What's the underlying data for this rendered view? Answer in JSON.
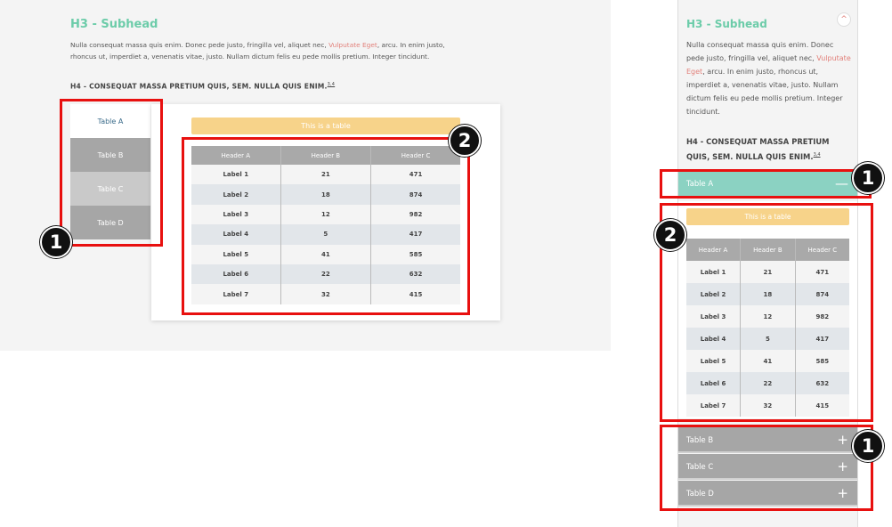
{
  "desktop": {
    "h3": "H3 - Subhead",
    "para_before": "Nulla consequat massa quis enim. Donec pede justo, fringilla vel, aliquet nec,",
    "para_link": "Vulputate Eget",
    "para_after": ", arcu. In enim justo, rhoncus ut, imperdiet a, venenatis vitae, justo. Nullam dictum felis eu pede mollis pretium. Integer tincidunt.",
    "h4": "H4 - CONSEQUAT MASSA PRETIUM QUIS, SEM. NULLA QUIS ENIM.",
    "h4_sup": "3,4",
    "tabs": [
      "Table A",
      "Table B",
      "Table C",
      "Table D"
    ],
    "caption": "This is a table"
  },
  "mobile": {
    "h3": "H3 - Subhead",
    "collapse_glyph": "^",
    "para_before": "Nulla consequat massa quis enim. Donec pede justo, fringilla vel, aliquet nec,",
    "para_link": "Vulputate Eget",
    "para_after": ", arcu. In enim justo, rhoncus ut, imperdiet a, venenatis vitae, justo. Nullam dictum felis eu pede mollis pretium. Integer tincidunt.",
    "h4": "H4 - CONSEQUAT MASSA PRETIUM QUIS, SEM. NULLA QUIS ENIM.",
    "h4_sup": "3,4",
    "acc_a": "Table A",
    "acc_a_sign": "—",
    "acc_b": "Table B",
    "acc_c": "Table C",
    "acc_d": "Table D",
    "plus_sign": "+",
    "caption": "This is a table"
  },
  "table": {
    "headers": [
      "Header A",
      "Header B",
      "Header C"
    ],
    "rows": [
      [
        "Label 1",
        "21",
        "471"
      ],
      [
        "Label 2",
        "18",
        "874"
      ],
      [
        "Label 3",
        "12",
        "982"
      ],
      [
        "Label 4",
        "5",
        "417"
      ],
      [
        "Label 5",
        "41",
        "585"
      ],
      [
        "Label 6",
        "22",
        "632"
      ],
      [
        "Label 7",
        "32",
        "415"
      ]
    ]
  },
  "annotations": {
    "badge_1": "1",
    "badge_2": "2"
  },
  "colors": {
    "accent_green": "#6ccca9",
    "link_red": "#e2807a",
    "caption_yellow": "#f7d38a",
    "annotation_red": "#e8100f"
  }
}
